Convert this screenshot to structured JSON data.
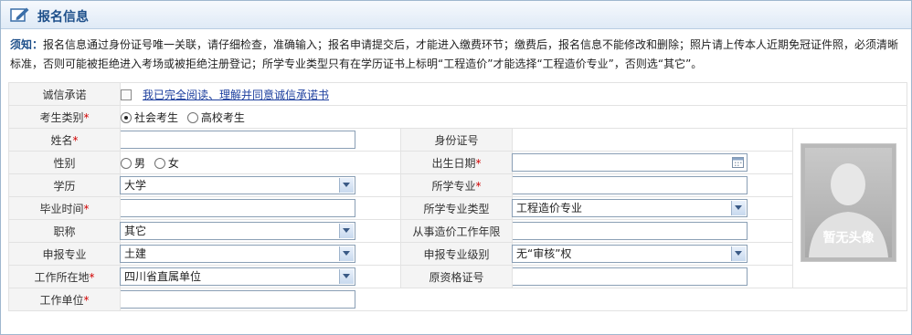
{
  "header": {
    "title": "报名信息",
    "icon": "edit-icon"
  },
  "notice": {
    "label": "须知：",
    "text": "报名信息通过身份证号唯一关联，请仔细检查，准确输入；报名申请提交后，才能进入缴费环节；缴费后，报名信息不能修改和删除；照片请上传本人近期免冠证件照，必须清晰标准，否则可能被拒绝进入考场或被拒绝注册登记；所学专业类型只有在学历证书上标明“工程造价”才能选择“工程造价专业”，否则选“其它”。"
  },
  "form": {
    "integrity": {
      "label": "诚信承诺",
      "link": "我已完全阅读、理解并同意诚信承诺书"
    },
    "category": {
      "label": "考生类别",
      "required": "*",
      "options": [
        "社会考生",
        "高校考生"
      ],
      "selected": "社会考生"
    },
    "name": {
      "label": "姓名",
      "required": "*",
      "value": ""
    },
    "id_number": {
      "label": "身份证号",
      "value": ""
    },
    "gender": {
      "label": "性别",
      "options": [
        "男",
        "女"
      ]
    },
    "birth_date": {
      "label": "出生日期",
      "required": "*",
      "value": ""
    },
    "education": {
      "label": "学历",
      "value": "大学"
    },
    "major": {
      "label": "所学专业",
      "required": "*",
      "value": ""
    },
    "grad_time": {
      "label": "毕业时间",
      "required": "*",
      "value": ""
    },
    "major_type": {
      "label": "所学专业类型",
      "value": "工程造价专业"
    },
    "title": {
      "label": "职称",
      "value": "其它"
    },
    "work_years": {
      "label": "从事造价工作年限",
      "value": ""
    },
    "apply_major": {
      "label": "申报专业",
      "value": "土建"
    },
    "apply_level": {
      "label": "申报专业级别",
      "value": "无“审核”权"
    },
    "location": {
      "label": "工作所在地",
      "required": "*",
      "value": "四川省直属单位"
    },
    "orig_cert": {
      "label": "原资格证号",
      "value": ""
    },
    "employer": {
      "label": "工作单位",
      "required": "*",
      "value": ""
    }
  },
  "photo": {
    "placeholder": "暂无头像"
  }
}
